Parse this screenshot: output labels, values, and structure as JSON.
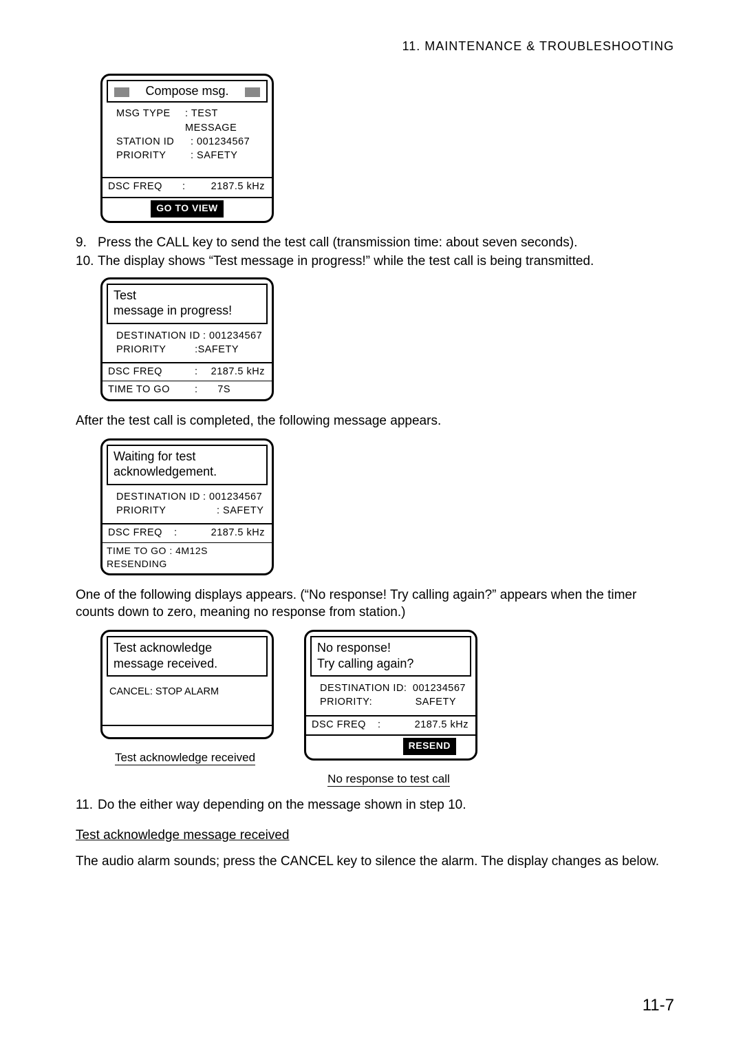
{
  "header": "11.  MAINTENANCE  &  TROUBLESHOOTING",
  "screen1": {
    "title": "Compose msg.",
    "msg_type_k": "MSG TYPE",
    "msg_type_v": ": TEST MESSAGE",
    "station_k": "STATION ID",
    "station_v": ":  001234567",
    "priority_k": "PRIORITY",
    "priority_v": ": SAFETY",
    "dsc_k": "DSC FREQ",
    "dsc_c": ":",
    "dsc_v": "2187.5 kHz",
    "button": "GO TO VIEW"
  },
  "step9_num": "9.",
  "step9_text": "Press the CALL key to send the test call (transmission time: about seven seconds).",
  "step10_num": "10.",
  "step10_text": "The display shows “Test message in progress!” while the test call is being transmitted.",
  "screen2": {
    "line1": "Test",
    "line2": "message in progress!",
    "dest_k": "DESTINATION ID",
    "dest_v": ":  001234567",
    "prio_k": "PRIORITY",
    "prio_v": ":SAFETY",
    "dsc_k": "DSC FREQ",
    "dsc_c": ":",
    "dsc_v": "2187.5 kHz",
    "time_k": "TIME TO GO",
    "time_c": ":",
    "time_v": "7S"
  },
  "para_after2": "After the test call is completed, the following message appears.",
  "screen3": {
    "line1": "Waiting for test",
    "line2": "acknowledgement.",
    "dest_k": "DESTINATION ID",
    "dest_v": ": 001234567",
    "prio_k": "PRIORITY",
    "prio_v": ": SAFETY",
    "dsc_k": "DSC FREQ",
    "dsc_c": ":",
    "dsc_v": "2187.5 kHz",
    "status": "TIME TO GO :  4M12S   RESENDING"
  },
  "para_after3": "One of the following displays appears. (“No response! Try calling again?” appears when the timer counts down to zero, meaning no response from station.)",
  "screen4": {
    "line1": "Test acknowledge",
    "line2": "message received.",
    "cancel": "CANCEL: STOP ALARM"
  },
  "caption4": "Test acknowledge received",
  "screen5": {
    "line1": "No response!",
    "line2": "Try calling again?",
    "dest_k": "DESTINATION ID:",
    "dest_v": "001234567",
    "prio_k": "PRIORITY:",
    "prio_v": "SAFETY",
    "dsc_k": "DSC FREQ",
    "dsc_c": ":",
    "dsc_v": "2187.5 kHz",
    "button": "RESEND"
  },
  "caption5": "No response to test call",
  "step11_num": "11.",
  "step11_text": "Do the either way depending on the message shown in step 10.",
  "subhead": "Test acknowledge message received",
  "para_final": "The audio alarm sounds; press the CANCEL key to silence the alarm. The display changes as below.",
  "page_number": "11-7"
}
